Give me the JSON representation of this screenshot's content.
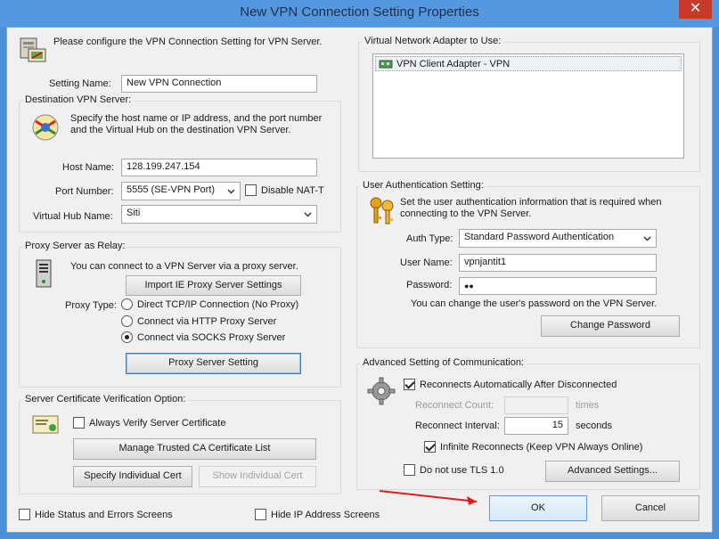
{
  "window": {
    "title": "New VPN Connection Setting Properties",
    "close_glyph": "✕"
  },
  "intro": {
    "text": "Please configure the VPN Connection Setting for VPN Server."
  },
  "setting_name": {
    "label": "Setting Name:",
    "value": "New VPN Connection"
  },
  "destination": {
    "legend": "Destination VPN Server:",
    "description_line1": "Specify the host name or IP address, and the port number",
    "description_line2": "and the Virtual Hub on the destination VPN Server.",
    "host_label": "Host Name:",
    "host_value": "128.199.247.154",
    "port_label": "Port Number:",
    "port_value": "5555 (SE-VPN Port)",
    "nat_t_label": "Disable NAT-T",
    "hub_label": "Virtual Hub Name:",
    "hub_value": "Siti"
  },
  "proxy": {
    "legend": "Proxy Server as Relay:",
    "description": "You can connect to a VPN Server via a proxy server.",
    "import_button": "Import IE Proxy Server Settings",
    "type_label": "Proxy Type:",
    "options": [
      "Direct TCP/IP Connection (No Proxy)",
      "Connect via HTTP Proxy Server",
      "Connect via SOCKS Proxy Server"
    ],
    "selected_index": 2,
    "setting_button": "Proxy Server Setting"
  },
  "cert": {
    "legend": "Server Certificate Verification Option:",
    "always_verify_label": "Always Verify Server Certificate",
    "manage_button": "Manage Trusted CA Certificate List",
    "specify_button": "Specify Individual Cert",
    "show_button": "Show Individual Cert"
  },
  "adapter": {
    "legend": "Virtual Network Adapter to Use:",
    "item": "VPN Client Adapter - VPN"
  },
  "auth": {
    "legend": "User Authentication Setting:",
    "description_line1": "Set the user authentication information that is required when",
    "description_line2": "connecting to the VPN Server.",
    "type_label": "Auth Type:",
    "type_value": "Standard Password Authentication",
    "user_label": "User Name:",
    "user_value": "vpnjantit1",
    "password_label": "Password:",
    "password_value": "●●",
    "change_note": "You can change the user's password on the VPN Server.",
    "change_button": "Change Password"
  },
  "advanced": {
    "legend": "Advanced Setting of Communication:",
    "reconnect_label": "Reconnects Automatically After Disconnected",
    "count_label": "Reconnect Count:",
    "count_value": "",
    "count_unit": "times",
    "interval_label": "Reconnect Interval:",
    "interval_value": "15",
    "interval_unit": "seconds",
    "infinite_label": "Infinite Reconnects (Keep VPN Always Online)",
    "no_tls_label": "Do not use TLS 1.0",
    "advanced_button": "Advanced Settings..."
  },
  "footer": {
    "hide_status_label": "Hide Status and Errors Screens",
    "hide_ip_label": "Hide IP Address Screens",
    "ok_button": "OK",
    "cancel_button": "Cancel"
  },
  "colors": {
    "title_bar": "#5498e0",
    "close_button": "#c7392b",
    "annotation_arrow": "#e01e1e"
  }
}
